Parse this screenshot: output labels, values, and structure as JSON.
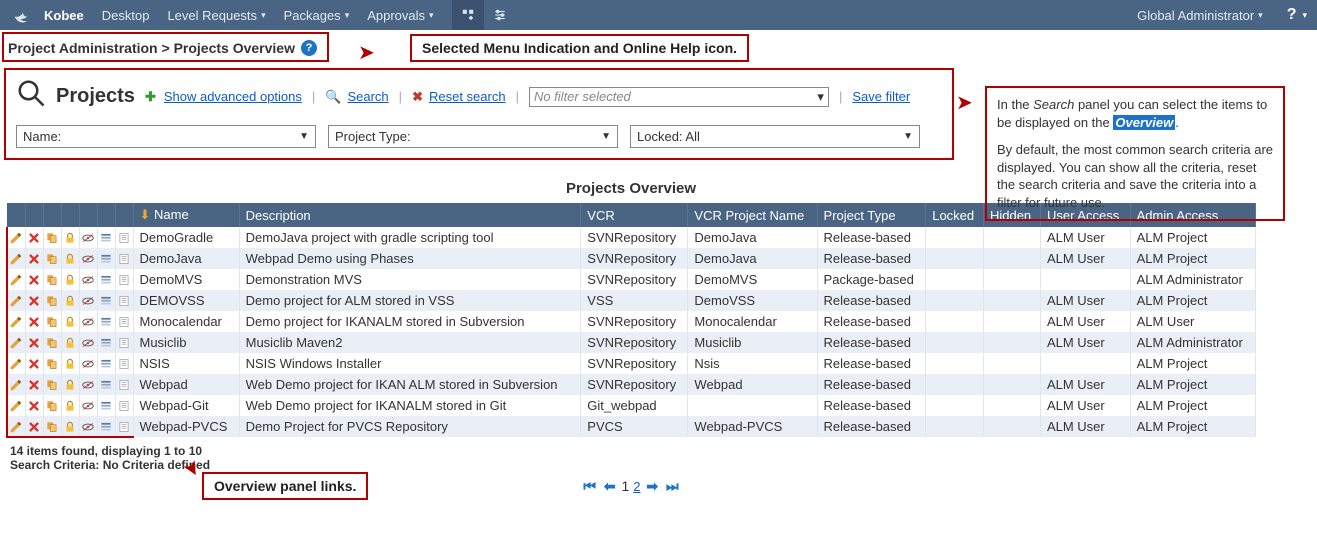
{
  "nav": {
    "brand": "Kobee",
    "items": [
      "Desktop",
      "Level Requests",
      "Packages",
      "Approvals"
    ],
    "rightUser": "Global Administrator"
  },
  "breadcrumb": "Project Administration > Projects Overview",
  "annot": {
    "menuHelp": "Selected Menu Indication and Online Help icon.",
    "overviewLinks": "Overview panel links."
  },
  "search": {
    "title": "Projects",
    "showAdvanced": "Show advanced options",
    "searchLabel": "Search",
    "resetLabel": "Reset search",
    "filterPlaceholder": "No filter selected",
    "saveFilter": "Save filter",
    "nameLabel": "Name:",
    "projTypeLabel": "Project Type:",
    "lockedLabel": "Locked: All"
  },
  "info": {
    "p1a": "In the ",
    "p1b": "Search",
    "p1c": " panel you can select the items to be displayed on the ",
    "p1d": "Overview",
    "p1e": ".",
    "p2": "By default, the most common search criteria are displayed. You can show all the criteria, reset the search criteria and save the criteria into a filter for future use."
  },
  "overview": {
    "title": "Projects Overview",
    "cols": [
      "Name",
      "Description",
      "VCR",
      "VCR Project Name",
      "Project Type",
      "Locked",
      "Hidden",
      "User Access",
      "Admin Access"
    ],
    "rows": [
      {
        "name": "DemoGradle",
        "desc": "DemoJava project with gradle scripting tool",
        "vcr": "SVNRepository",
        "vpn": "DemoJava",
        "pt": "Release-based",
        "lk": "",
        "hd": "",
        "ua": "ALM User",
        "aa": "ALM Project"
      },
      {
        "name": "DemoJava",
        "desc": "Webpad Demo using Phases",
        "vcr": "SVNRepository",
        "vpn": "DemoJava",
        "pt": "Release-based",
        "lk": "",
        "hd": "",
        "ua": "ALM User",
        "aa": "ALM Project"
      },
      {
        "name": "DemoMVS",
        "desc": "Demonstration MVS",
        "vcr": "SVNRepository",
        "vpn": "DemoMVS",
        "pt": "Package-based",
        "lk": "",
        "hd": "",
        "ua": "",
        "aa": "ALM Administrator"
      },
      {
        "name": "DEMOVSS",
        "desc": "Demo project for ALM stored in VSS",
        "vcr": "VSS",
        "vpn": "DemoVSS",
        "pt": "Release-based",
        "lk": "",
        "hd": "",
        "ua": "ALM User",
        "aa": "ALM Project"
      },
      {
        "name": "Monocalendar",
        "desc": "Demo project for IKANALM stored in Subversion",
        "vcr": "SVNRepository",
        "vpn": "Monocalendar",
        "pt": "Release-based",
        "lk": "",
        "hd": "",
        "ua": "ALM User",
        "aa": "ALM User"
      },
      {
        "name": "Musiclib",
        "desc": "Musiclib Maven2",
        "vcr": "SVNRepository",
        "vpn": "Musiclib",
        "pt": "Release-based",
        "lk": "",
        "hd": "",
        "ua": "ALM User",
        "aa": "ALM Administrator"
      },
      {
        "name": "NSIS",
        "desc": "NSIS Windows Installer",
        "vcr": "SVNRepository",
        "vpn": "Nsis",
        "pt": "Release-based",
        "lk": "",
        "hd": "",
        "ua": "",
        "aa": "ALM Project"
      },
      {
        "name": "Webpad",
        "desc": "Web Demo project for IKAN ALM stored in Subversion",
        "vcr": "SVNRepository",
        "vpn": "Webpad",
        "pt": "Release-based",
        "lk": "",
        "hd": "",
        "ua": "ALM User",
        "aa": "ALM Project"
      },
      {
        "name": "Webpad-Git",
        "desc": "Web Demo project for IKANALM stored in Git",
        "vcr": "Git_webpad",
        "vpn": "",
        "pt": "Release-based",
        "lk": "",
        "hd": "",
        "ua": "ALM User",
        "aa": "ALM Project"
      },
      {
        "name": "Webpad-PVCS",
        "desc": "Demo Project for PVCS Repository",
        "vcr": "PVCS",
        "vpn": "Webpad-PVCS",
        "pt": "Release-based",
        "lk": "",
        "hd": "",
        "ua": "ALM User",
        "aa": "ALM Project"
      }
    ],
    "footCount": "14 items found, displaying 1 to 10",
    "footCriteria": "Search Criteria: No Criteria defined",
    "page1": "1",
    "page2": "2"
  }
}
